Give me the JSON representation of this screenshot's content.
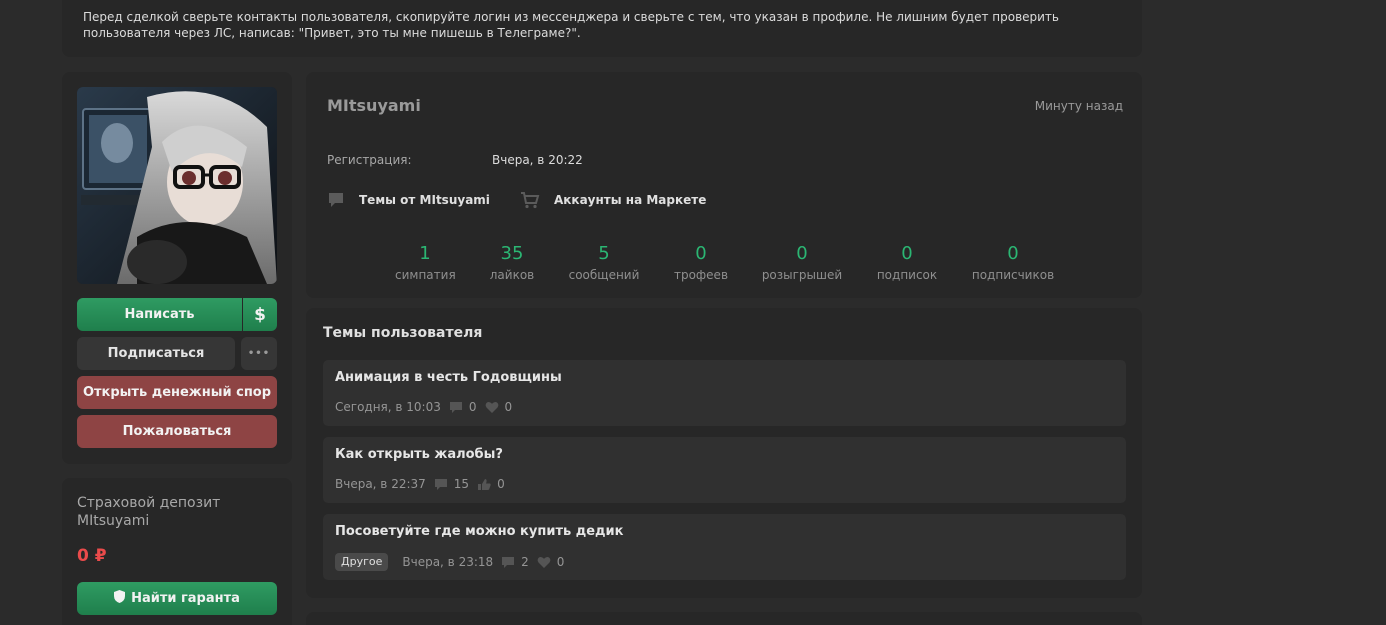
{
  "notice": {
    "line1": "Перед сделкой сверьте контакты пользователя, скопируйте логин из мессенджера и сверьте с тем, что указан в профиле. Не лишним будет проверить",
    "line2": "пользователя через ЛС, написав: \"Привет, это ты мне пишешь в Телеграме?\"."
  },
  "sidebar": {
    "write_label": "Написать",
    "money_icon": "$",
    "subscribe_label": "Подписаться",
    "more_icon": "•••",
    "dispute_label": "Открыть денежный спор",
    "report_label": "Пожаловаться"
  },
  "deposit": {
    "title": "Страховой депозит MItsuyami",
    "amount": "0 ₽",
    "guarantor_label": "Найти гаранта"
  },
  "profile": {
    "username": "MItsuyami",
    "last_seen": "Минуту назад",
    "registration_label": "Регистрация:",
    "registration_value": "Вчера, в 20:22",
    "threads_link": "Темы от MItsuyami",
    "market_link": "Аккаунты на Маркете",
    "stats": [
      {
        "value": "1",
        "label": "симпатия"
      },
      {
        "value": "35",
        "label": "лайков"
      },
      {
        "value": "5",
        "label": "сообщений"
      },
      {
        "value": "0",
        "label": "трофеев"
      },
      {
        "value": "0",
        "label": "розыгрышей"
      },
      {
        "value": "0",
        "label": "подписок"
      },
      {
        "value": "0",
        "label": "подписчиков"
      }
    ]
  },
  "threads": {
    "heading": "Темы пользователя",
    "items": [
      {
        "title": "Анимация в честь Годовщины",
        "tag": "",
        "time": "Сегодня, в 10:03",
        "replies": "0",
        "likes": "0",
        "like_icon": "heart-icon"
      },
      {
        "title": "Как открыть жалобы?",
        "tag": "",
        "time": "Вчера, в 22:37",
        "replies": "15",
        "likes": "0",
        "like_icon": "thumbs-up-icon"
      },
      {
        "title": "Посоветуйте где можно купить дедик",
        "tag": "Другое",
        "time": "Вчера, в 23:18",
        "replies": "2",
        "likes": "0",
        "like_icon": "heart-icon"
      }
    ]
  },
  "colors": {
    "accent_green": "#2bb673",
    "button_green": "#228b55",
    "button_red": "#8e4444",
    "amount_red": "#ea4b4b",
    "background": "#2b2b2b",
    "card": "#272727"
  }
}
